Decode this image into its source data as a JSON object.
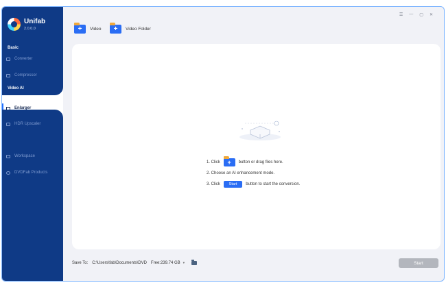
{
  "app": {
    "brand": "Unifab",
    "version": "2.0.0.0"
  },
  "sidebar": {
    "sections": [
      {
        "title": "Basic",
        "items": [
          {
            "label": "Converter",
            "icon": "play-icon"
          },
          {
            "label": "Compressor",
            "icon": "compress-icon"
          }
        ]
      },
      {
        "title": "Video AI",
        "items": [
          {
            "label": "Enlarger",
            "icon": "enlarger-icon",
            "active": true
          },
          {
            "label": "HDR Upscaler",
            "icon": "hdr-icon"
          }
        ]
      }
    ],
    "extra": [
      {
        "label": "Workspace",
        "icon": "workspace-icon"
      },
      {
        "label": "DVDFab Products",
        "icon": "products-icon"
      }
    ]
  },
  "toolbar": {
    "video_label": "Video",
    "video_folder_label": "Video Folder"
  },
  "window_controls": [
    "☰",
    "—",
    "▢",
    "✕"
  ],
  "instructions": {
    "step1_prefix": "1. Click",
    "step1_suffix": "button or drag files here.",
    "step2": "2. Choose an AI enhancement mode.",
    "step3_prefix": "3. Click",
    "step3_button": "Start",
    "step3_suffix": "button to start the conversion."
  },
  "bottom": {
    "save_to_label": "Save To:",
    "path": "C:\\Users\\fab\\Documents\\DVD",
    "free_space": "Free:239.74 GB",
    "start_label": "Start"
  },
  "colors": {
    "sidebar": "#0f3a86",
    "accent": "#2a6df4",
    "disabled": "#b3b6bd"
  }
}
